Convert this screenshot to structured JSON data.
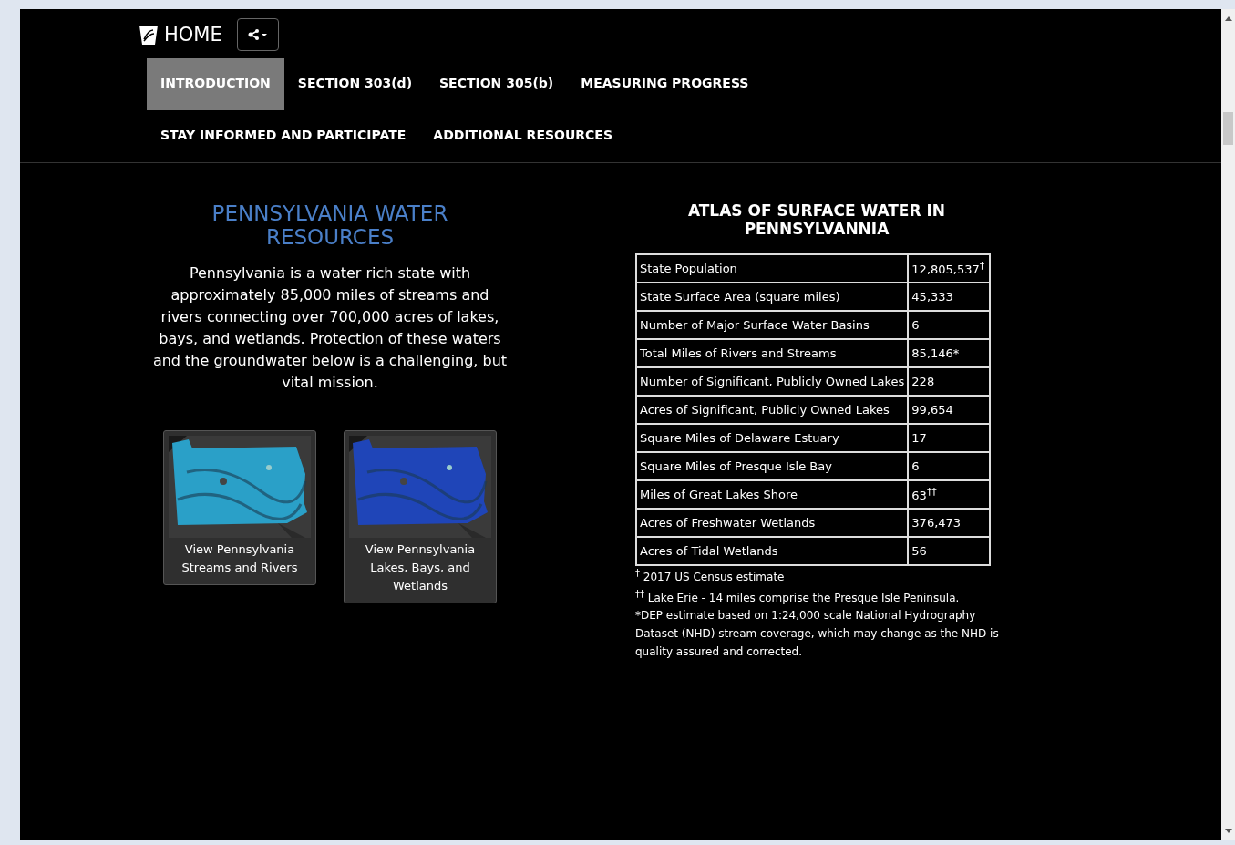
{
  "header": {
    "home_label": "HOME"
  },
  "tabs": [
    {
      "label": "INTRODUCTION",
      "selected": true
    },
    {
      "label": "SECTION 303(d)",
      "selected": false
    },
    {
      "label": "SECTION 305(b)",
      "selected": false
    },
    {
      "label": "MEASURING PROGRESS",
      "selected": false
    },
    {
      "label": "STAY INFORMED AND PARTICIPATE",
      "selected": false
    },
    {
      "label": "ADDITIONAL RESOURCES",
      "selected": false
    }
  ],
  "intro": {
    "title": "PENNSYLVANIA WATER RESOURCES",
    "text": "Pennsylvania is a water rich state with approximately 85,000 miles of streams and rivers connecting over 700,000 acres of lakes, bays, and wetlands. Protection of these waters and the groundwater below is a challenging, but vital mission."
  },
  "map_cards": [
    {
      "caption": "View Pennsylvania Streams and Rivers",
      "kind": "streams"
    },
    {
      "caption": "View Pennsylvania Lakes, Bays, and Wetlands",
      "kind": "lakes"
    }
  ],
  "atlas": {
    "title": "ATLAS OF SURFACE WATER IN PENNSYLVANNIA",
    "rows": [
      [
        "State Population",
        "12,805,537$^{†}$"
      ],
      [
        "State Surface Area (square miles)",
        "45,333"
      ],
      [
        "Number of Major Surface Water Basins",
        "6"
      ],
      [
        "Total Miles of Rivers and Streams",
        "85,146*"
      ],
      [
        "Number of Significant, Publicly Owned Lakes",
        "228"
      ],
      [
        "Acres of Significant, Publicly Owned Lakes",
        "99,654"
      ],
      [
        "Square Miles of Delaware Estuary",
        "17"
      ],
      [
        "Square Miles of Presque Isle Bay",
        "6"
      ],
      [
        "Miles of Great Lakes Shore",
        "63$^{††}$"
      ],
      [
        "Acres of Freshwater Wetlands",
        "376,473"
      ],
      [
        "Acres of Tidal Wetlands",
        "56"
      ]
    ],
    "footnotes": [
      "$^{†}$ 2017 US Census estimate",
      "$^{††}$ Lake Erie - 14 miles comprise the Presque Isle Peninsula.",
      "*DEP estimate based on 1:24,000 scale National Hydrography Dataset (NHD) stream coverage, which may change as the NHD is quality assured and corrected."
    ]
  }
}
